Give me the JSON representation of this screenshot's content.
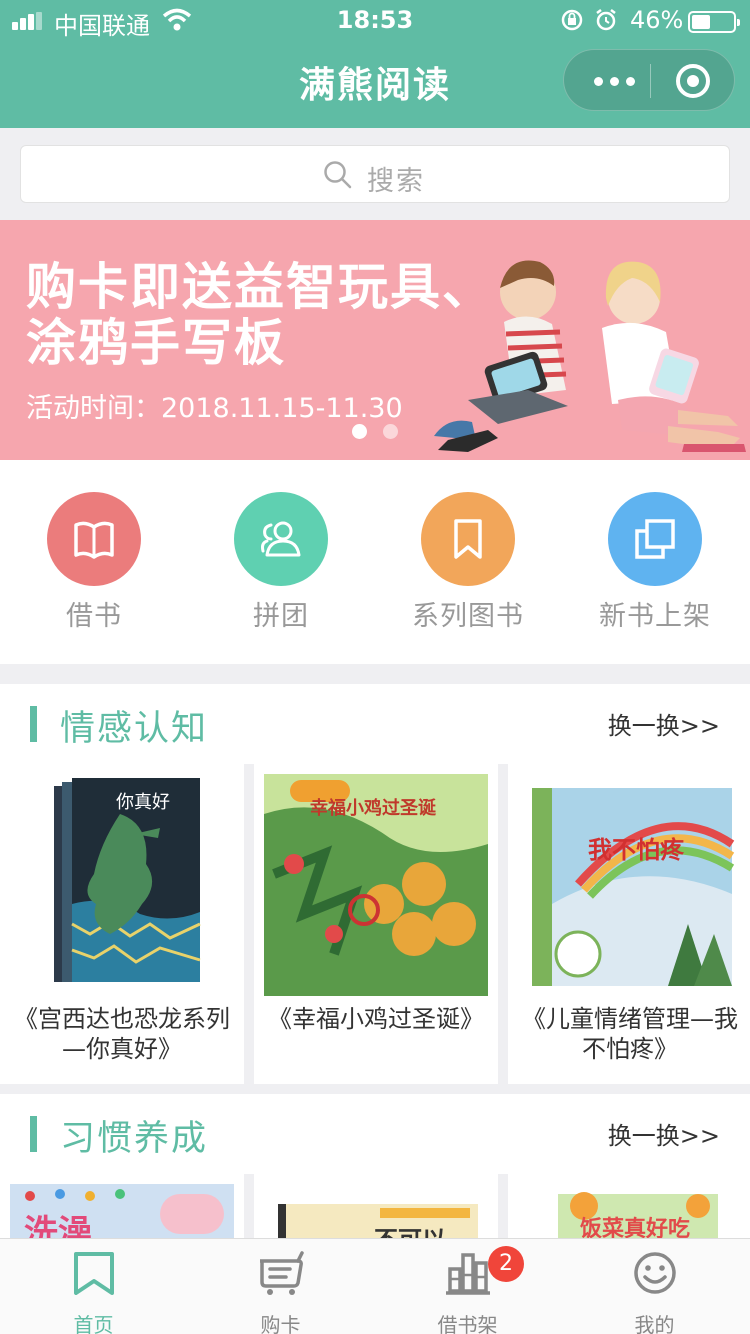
{
  "status_bar": {
    "carrier": "中国联通",
    "time": "18:53",
    "battery": "46%",
    "battery_level": 0.46
  },
  "nav": {
    "title": "满熊阅读"
  },
  "search": {
    "placeholder": "搜索"
  },
  "banner": {
    "line1": "购卡即送益智玩具、",
    "line2": "涂鸦手写板",
    "date": "活动时间：2018.11.15-11.30",
    "pages": 2,
    "active_page": 1,
    "color": "#f6a6ae"
  },
  "categories": [
    {
      "label": "借书",
      "icon": "open-book-icon",
      "color": "#eb7c7c"
    },
    {
      "label": "拼团",
      "icon": "group-icon",
      "color": "#5fd0b1"
    },
    {
      "label": "系列图书",
      "icon": "bookmark-icon",
      "color": "#f2a65a"
    },
    {
      "label": "新书上架",
      "icon": "layers-icon",
      "color": "#5fb3f0"
    }
  ],
  "sections": [
    {
      "title": "情感认知",
      "more": "换一换>>",
      "books": [
        {
          "title": "《宫西达也恐龙系列—你真好》"
        },
        {
          "title": "《幸福小鸡过圣诞》"
        },
        {
          "title": "《儿童情绪管理—我不怕疼》"
        }
      ]
    },
    {
      "title": "习惯养成",
      "more": "换一换>>",
      "books": [
        {
          "title": ""
        },
        {
          "title": ""
        },
        {
          "title": ""
        }
      ]
    }
  ],
  "covers": {
    "book1": "你真好",
    "book2": "幸福小鸡过圣诞",
    "book3": "我不怕疼",
    "book4": "洗澡",
    "book5": "不可以",
    "book6": "饭菜真好吃"
  },
  "tabbar": {
    "tabs": [
      {
        "label": "首页",
        "icon": "home-bookmark-icon",
        "active": true
      },
      {
        "label": "购卡",
        "icon": "cart-icon",
        "active": false
      },
      {
        "label": "借书架",
        "icon": "bookshelf-icon",
        "active": false
      },
      {
        "label": "我的",
        "icon": "smile-icon",
        "active": false
      }
    ],
    "badge": "2"
  },
  "colors": {
    "accent": "#5fbca4",
    "badge": "#f0453a"
  }
}
